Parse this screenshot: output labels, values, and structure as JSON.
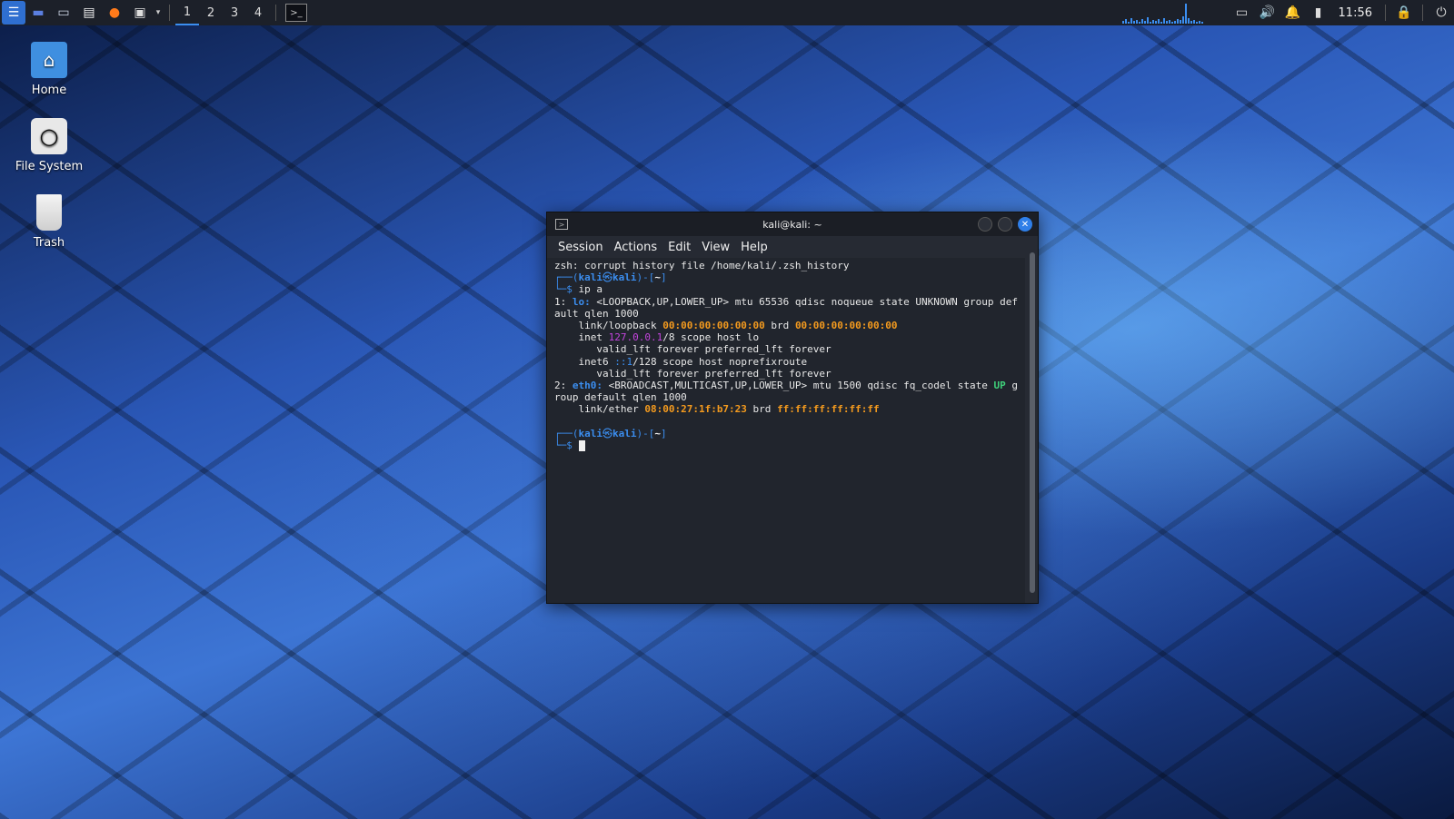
{
  "panel": {
    "workspaces": [
      "1",
      "2",
      "3",
      "4"
    ],
    "active_workspace": "1",
    "clock": "11:56",
    "icons": [
      "kali-menu-icon",
      "show-desktop-icon",
      "file-manager-icon",
      "text-editor-icon",
      "firefox-icon",
      "terminal-icon",
      "terminal-dropdown-icon",
      "task-terminal-icon",
      "network-graph",
      "screen-icon",
      "volume-icon",
      "notification-icon",
      "battery-icon",
      "lock-icon",
      "power-icon"
    ]
  },
  "desktop": {
    "icons": [
      {
        "label": "Home"
      },
      {
        "label": "File System"
      },
      {
        "label": "Trash"
      }
    ]
  },
  "terminal": {
    "title": "kali@kali: ~",
    "menu": [
      "Session",
      "Actions",
      "Edit",
      "View",
      "Help"
    ],
    "lines": {
      "l1": "zsh: corrupt history file /home/kali/.zsh_history",
      "prompt_user": "kali",
      "prompt_at": "㉿",
      "prompt_host": "kali",
      "prompt_dir": "~",
      "cmd": "ip a",
      "if1_a": "1: ",
      "if1_name": "lo:",
      "if1_b": " <LOOPBACK,UP,LOWER_UP> mtu 65536 qdisc noqueue state UNKNOWN group def",
      "if1_c": "ault qlen 1000",
      "ll_a": "    link/loopback ",
      "ll_mac": "00:00:00:00:00:00",
      "ll_b": " brd ",
      "ll_brd": "00:00:00:00:00:00",
      "inet_a": "    inet ",
      "inet_ip": "127.0.0.1",
      "inet_b": "/8 scope host lo",
      "valid1": "       valid_lft forever preferred_lft forever",
      "inet6_a": "    inet6 ",
      "inet6_ip": "::1",
      "inet6_b": "/128 scope host noprefixroute",
      "valid2": "       valid_lft forever preferred_lft forever",
      "if2_a": "2: ",
      "if2_name": "eth0:",
      "if2_b": " <BROADCAST,MULTICAST,UP,LOWER_UP> mtu 1500 qdisc fq_codel state ",
      "if2_up": "UP",
      "if2_c": " g",
      "if2_d": "roup default qlen 1000",
      "le_a": "    link/ether ",
      "le_mac": "08:00:27:1f:b7:23",
      "le_b": " brd ",
      "le_brd": "ff:ff:ff:ff:ff:ff"
    }
  }
}
